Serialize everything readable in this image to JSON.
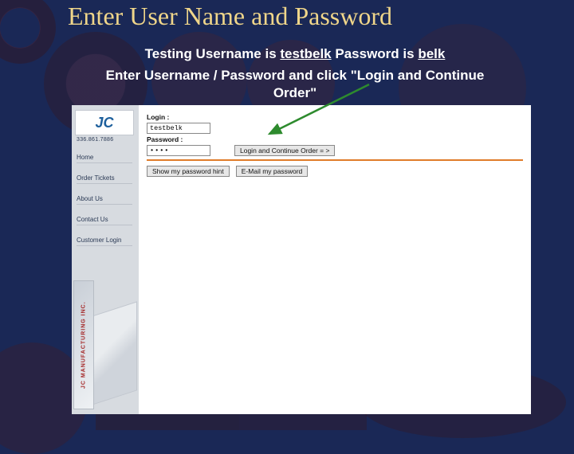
{
  "slide": {
    "title": "Enter User Name and Password",
    "sub_prefix": "Testing Username is ",
    "sub_user": "testbelk",
    "sub_mid": "  Password is ",
    "sub_pass": "belk",
    "sub2": "Enter Username / Password and click \"Login and Continue Order\""
  },
  "panel": {
    "phone": "336.861.7886",
    "sidebar": {
      "home": "Home",
      "order": "Order Tickets",
      "about": "About Us",
      "contact": "Contact Us",
      "login": "Customer Login",
      "vertical": "JC MANUFACTURING INC."
    },
    "form": {
      "login_label": "Login :",
      "password_label": "Password :",
      "username_value": "testbelk",
      "password_value": "••••",
      "login_button": "Login and Continue Order  = >",
      "hint_button": "Show my password hint",
      "email_button": "E-Mail my password"
    }
  }
}
